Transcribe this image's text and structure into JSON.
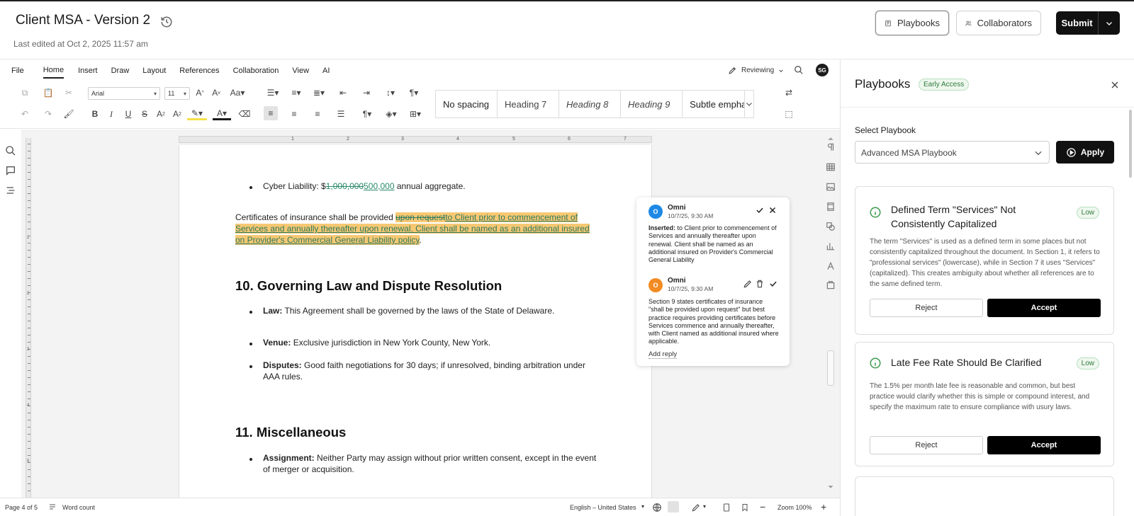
{
  "header": {
    "title": "Client MSA - Version 2",
    "last_edited": "Last edited at Oct 2, 2025 11:57 am",
    "playbooks_label": "Playbooks",
    "collaborators_label": "Collaborators",
    "submit_label": "Submit"
  },
  "menu": {
    "items": [
      "File",
      "Home",
      "Insert",
      "Draw",
      "Layout",
      "References",
      "Collaboration",
      "View",
      "AI"
    ],
    "active": "Home",
    "reviewing_label": "Reviewing",
    "user_initials": "SG"
  },
  "toolbar": {
    "font": "Arial",
    "size": "11",
    "styles": [
      "No spacing",
      "Heading 7",
      "Heading 8",
      "Heading 9",
      "Subtle empha"
    ]
  },
  "document": {
    "bullet_cyber_prefix": "Cyber Liability: $",
    "bullet_cyber_deleted": "1,000,000",
    "bullet_cyber_inserted": "500,000",
    "bullet_cyber_suffix": " annual aggregate.",
    "cert_prefix": "Certificates of insurance shall be provided ",
    "cert_deleted": "upon request",
    "cert_inserted_line1": "to Client prior to commencement of",
    "cert_inserted_line2": "Services and annually thereafter upon renewal. Client shall be named as an additional insured",
    "cert_inserted_line3": "on Provider's Commercial General Liability policy",
    "cert_end": ".",
    "h10": "10. Governing Law and Dispute Resolution",
    "law_label": "Law:",
    "law_text": " This Agreement shall be governed by the laws of the State of Delaware.",
    "venue_label": "Venue:",
    "venue_text": " Exclusive jurisdiction in New York County, New York.",
    "disputes_label": "Disputes:",
    "disputes_text_1": " Good faith negotiations for 30 days; if unresolved, binding arbitration under",
    "disputes_text_2": "AAA rules.",
    "h11": "11. Miscellaneous",
    "assign_label": "Assignment:",
    "assign_text_1": " Neither Party may assign without prior written consent, except in the event",
    "assign_text_2": "of merger or acquisition."
  },
  "comments": [
    {
      "initial": "O",
      "author": "Omni",
      "date": "10/7/25, 9:30 AM",
      "label": "Inserted:",
      "body": " to Client prior to commencement of Services and annually thereafter upon renewal. Client shall be named as an additional insured on Provider's Commercial General Liability",
      "color": "#1e88e5"
    },
    {
      "initial": "O",
      "author": "Omni",
      "date": "10/7/25, 9:30 AM",
      "body": "Section 9 states certificates of insurance \"shall be provided upon request\" but best practice requires providing certificates before Services commence and annually thereafter, with Client named as additional insured where applicable.",
      "color": "#f28b22"
    }
  ],
  "add_reply": "Add reply",
  "status": {
    "page": "Page 4 of 5",
    "word_count": "Word count",
    "language": "English – United States",
    "zoom": "Zoom 100%"
  },
  "panel": {
    "title": "Playbooks",
    "badge": "Early Access",
    "select_label": "Select Playbook",
    "select_value": "Advanced MSA Playbook",
    "apply_label": "Apply",
    "cards": [
      {
        "title": "Defined Term \"Services\" Not Consistently Capitalized",
        "badge": "Low",
        "desc": "The term \"Services\" is used as a defined term in some places but not consistently capitalized throughout the document. In Section 1, it refers to \"professional services\" (lowercase), while in Section 7 it uses \"Services\" (capitalized). This creates ambiguity about whether all references are to the same defined term.",
        "reject": "Reject",
        "accept": "Accept"
      },
      {
        "title": "Late Fee Rate Should Be Clarified",
        "badge": "Low",
        "desc": "The 1.5% per month late fee is reasonable and common, but best practice would clarify whether this is simple or compound interest, and specify the maximum rate to ensure compliance with usury laws.",
        "reject": "Reject",
        "accept": "Accept"
      }
    ]
  },
  "ruler": {
    "h_numbers": [
      "1",
      "2",
      "3",
      "4",
      "5",
      "6",
      "7"
    ],
    "v_numbers": [
      "1",
      "2",
      "3",
      "4",
      "5"
    ]
  }
}
